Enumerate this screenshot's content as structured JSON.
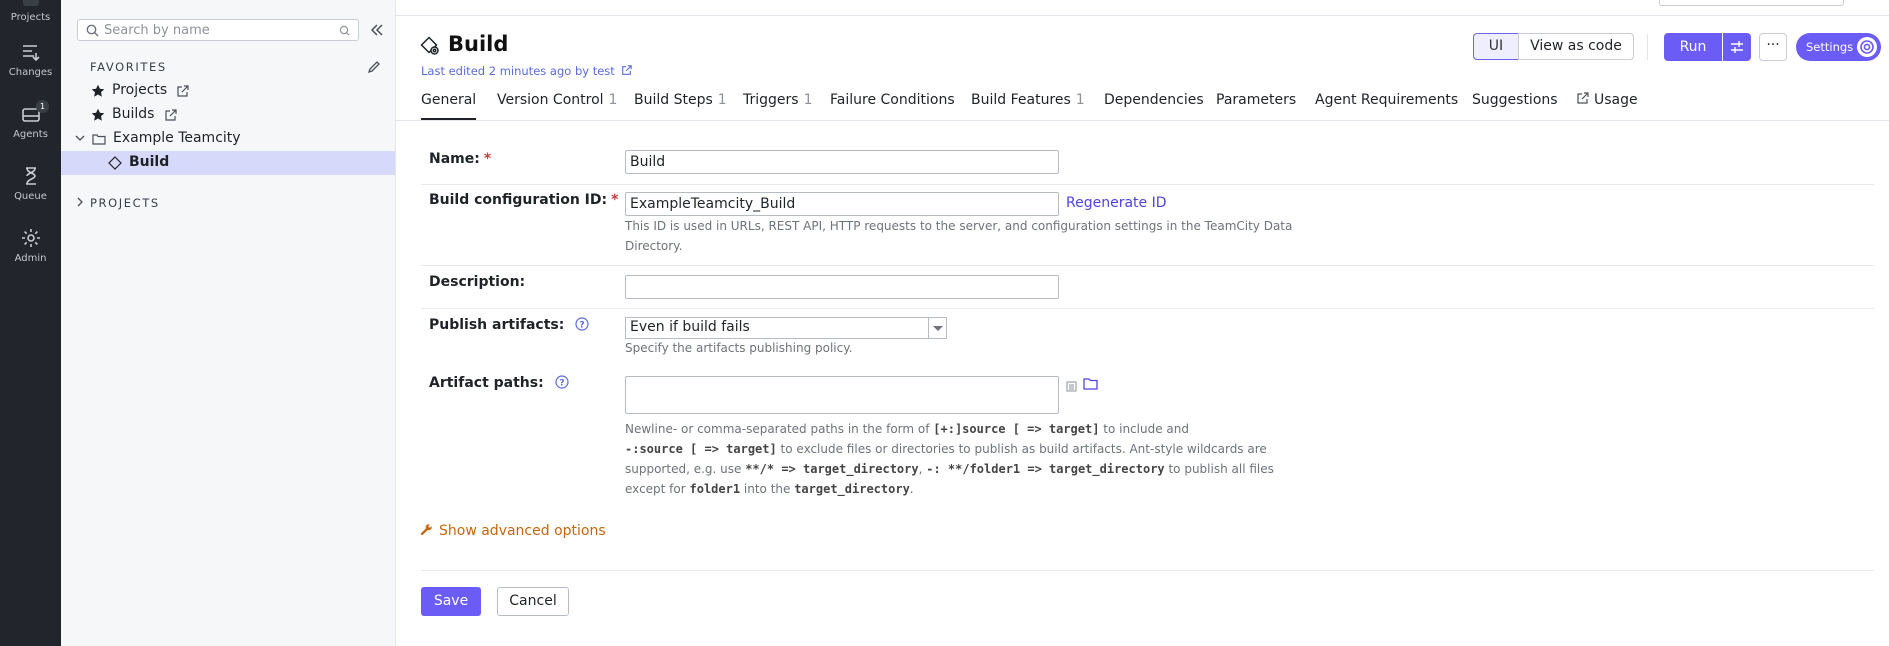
{
  "rail": {
    "items": [
      {
        "label": "Projects",
        "icon": "projects-icon"
      },
      {
        "label": "Changes",
        "icon": "changes-icon"
      },
      {
        "label": "Agents",
        "icon": "agents-icon",
        "badge": "1"
      },
      {
        "label": "Queue",
        "icon": "queue-icon"
      },
      {
        "label": "Admin",
        "icon": "admin-gear-icon"
      }
    ]
  },
  "sidebar": {
    "search_placeholder": "Search by name",
    "favorites_heading": "FAVORITES",
    "favorites": [
      {
        "label": "Projects"
      },
      {
        "label": "Builds"
      }
    ],
    "tree": [
      {
        "label": "Example Teamcity"
      },
      {
        "label": "Build",
        "selected": true
      }
    ],
    "projects_heading": "PROJECTS"
  },
  "header": {
    "title": "Build",
    "meta_prefix": "Last edited",
    "meta_time": "2 minutes ago",
    "meta_by": "by test",
    "view_ui": "UI",
    "view_code": "View as code",
    "run": "Run",
    "more": "···",
    "settings": "Settings"
  },
  "tabs": [
    {
      "label": "General",
      "count": "",
      "active": true
    },
    {
      "label": "Version Control",
      "count": "1"
    },
    {
      "label": "Build Steps",
      "count": "1"
    },
    {
      "label": "Triggers",
      "count": "1"
    },
    {
      "label": "Failure Conditions",
      "count": ""
    },
    {
      "label": "Build Features",
      "count": "1"
    },
    {
      "label": "Dependencies",
      "count": ""
    },
    {
      "label": "Parameters",
      "count": ""
    },
    {
      "label": "Agent Requirements",
      "count": ""
    },
    {
      "label": "Suggestions",
      "count": ""
    },
    {
      "label": "Usage",
      "count": ""
    }
  ],
  "form": {
    "name_label": "Name:",
    "name_value": "Build",
    "required_mark": "*",
    "config_id_label": "Build configuration ID:",
    "config_id_value": "ExampleTeamcity_Build",
    "regenerate": "Regenerate ID",
    "config_id_hint_1": "This ID is used in URLs, REST API, HTTP requests to the server, and configuration settings in the TeamCity Data",
    "config_id_hint_2": "Directory.",
    "description_label": "Description:",
    "description_value": "",
    "publish_label": "Publish artifacts:",
    "publish_value": "Even if build fails",
    "publish_hint": "Specify the artifacts publishing policy.",
    "artifact_label": "Artifact paths:",
    "artifact_hint": {
      "l1a": "Newline- or comma-separated paths in the form of ",
      "l1code": "[+:]source [ => target]",
      "l1b": " to include and",
      "l2code": "-:source [ => target]",
      "l2b": " to exclude files or directories to publish as build artifacts. Ant-style wildcards are",
      "l3a": "supported, e.g. use ",
      "l3code1": "**/* => target_directory",
      "l3b": ", ",
      "l3code2": "-: **/folder1 => target_directory",
      "l3c": " to publish all files",
      "l4a": "except for ",
      "l4code1": "folder1",
      "l4b": " into the ",
      "l4code2": "target_directory",
      "l4c": "."
    },
    "advanced": "Show advanced options",
    "save": "Save",
    "cancel": "Cancel"
  }
}
